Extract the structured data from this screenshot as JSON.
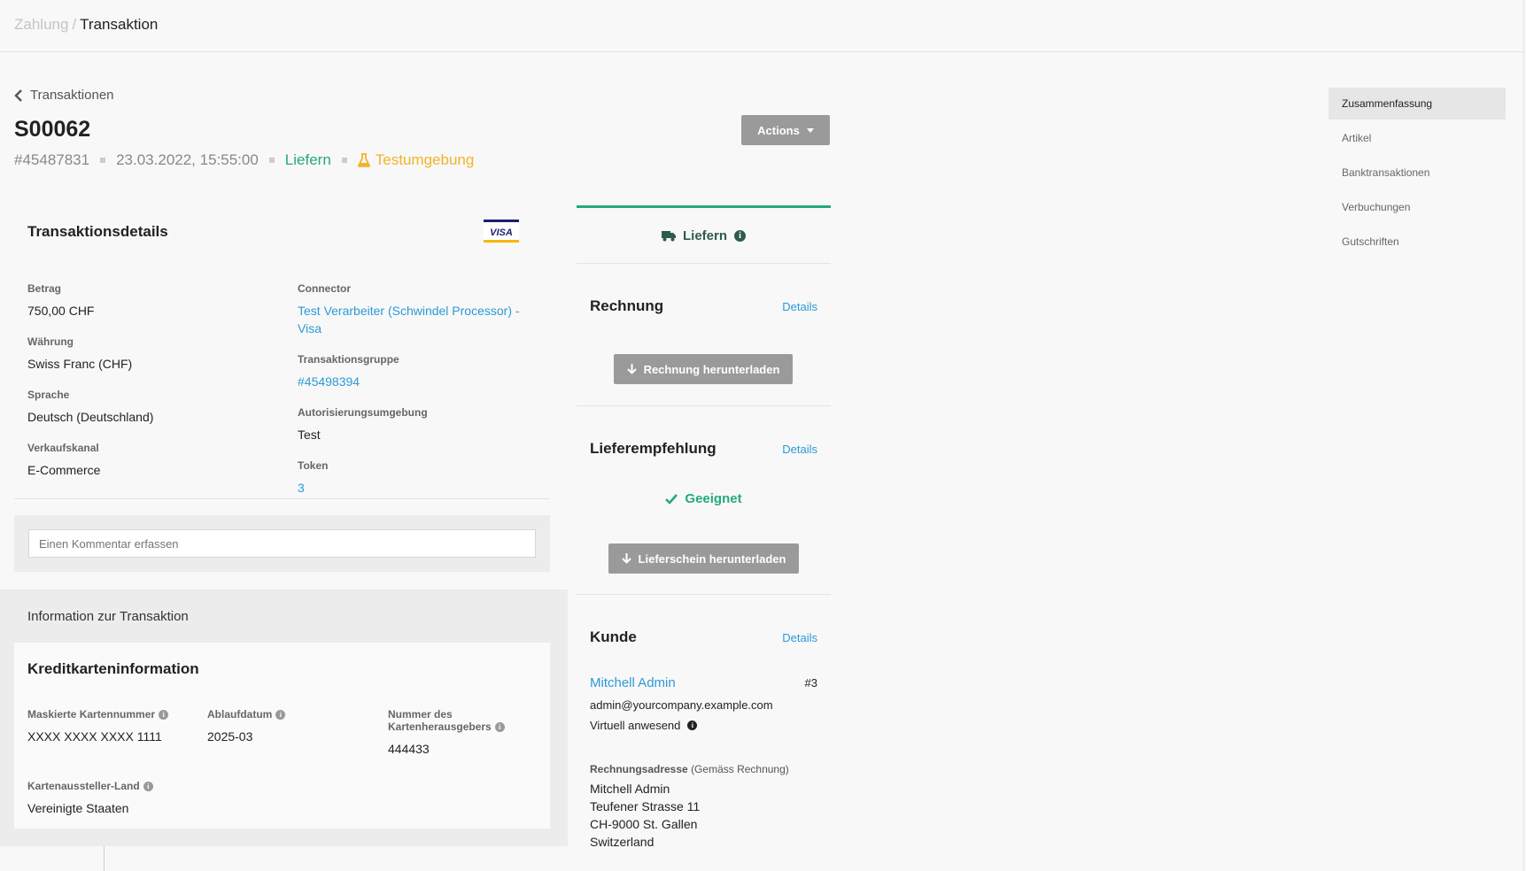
{
  "breadcrumb": {
    "parent": "Zahlung",
    "separator": "/",
    "current": "Transaktion"
  },
  "header": {
    "back_label": "Transaktionen",
    "title": "S00062",
    "transaction_id": "#45487831",
    "datetime": "23.03.2022, 15:55:00",
    "state": "Liefern",
    "environment": "Testumgebung",
    "actions_label": "Actions"
  },
  "details": {
    "title": "Transaktionsdetails",
    "logo": "VISA",
    "left": [
      {
        "label": "Betrag",
        "value": "750,00 CHF"
      },
      {
        "label": "Währung",
        "value": "Swiss Franc (CHF)"
      },
      {
        "label": "Sprache",
        "value": "Deutsch (Deutschland)"
      },
      {
        "label": "Verkaufskanal",
        "value": "E-Commerce"
      }
    ],
    "connector": {
      "label": "Connector",
      "value_line1": "Test Verarbeiter (Schwindel Processor) -",
      "value_line2": "Visa"
    },
    "group": {
      "label": "Transaktionsgruppe",
      "value": "#45498394"
    },
    "auth_env": {
      "label": "Autorisierungsumgebung",
      "value": "Test"
    },
    "token": {
      "label": "Token",
      "value": "3"
    }
  },
  "comment": {
    "placeholder": "Einen Kommentar erfassen"
  },
  "info": {
    "title": "Information zur Transaktion",
    "card_title": "Kreditkarteninformation",
    "masked": {
      "label": "Maskierte Kartennummer",
      "value": "XXXX XXXX XXXX 1111"
    },
    "expiry": {
      "label": "Ablaufdatum",
      "value": "2025-03"
    },
    "issuer_number": {
      "label_line1": "Nummer des",
      "label_line2": "Kartenherausgebers",
      "value": "444433"
    },
    "issuer_country": {
      "label": "Kartenaussteller-Land",
      "value": "Vereinigte Staaten"
    }
  },
  "status_panel": {
    "state_label": "Liefern",
    "invoice": {
      "title": "Rechnung",
      "details": "Details",
      "button": "Rechnung herunterladen"
    },
    "delivery": {
      "title": "Lieferempfehlung",
      "details": "Details",
      "status": "Geeignet",
      "button": "Lieferschein herunterladen"
    },
    "customer": {
      "title": "Kunde",
      "details": "Details",
      "name": "Mitchell Admin",
      "id": "#3",
      "email": "admin@yourcompany.example.com",
      "presence": "Virtuell anwesend",
      "address_label": "Rechnungsadresse",
      "address_note": "(Gemäss Rechnung)",
      "address": [
        "Mitchell Admin",
        "Teufener Strasse 11",
        "CH-9000 St. Gallen",
        "Switzerland"
      ]
    }
  },
  "sidenav": [
    "Zusammenfassung",
    "Artikel",
    "Banktransaktionen",
    "Verbuchungen",
    "Gutschriften"
  ],
  "colors": {
    "accent_green": "#26a97a",
    "link_blue": "#2b9ad6",
    "warning_yellow": "#f0b429",
    "button_gray": "#9a9a9a"
  }
}
